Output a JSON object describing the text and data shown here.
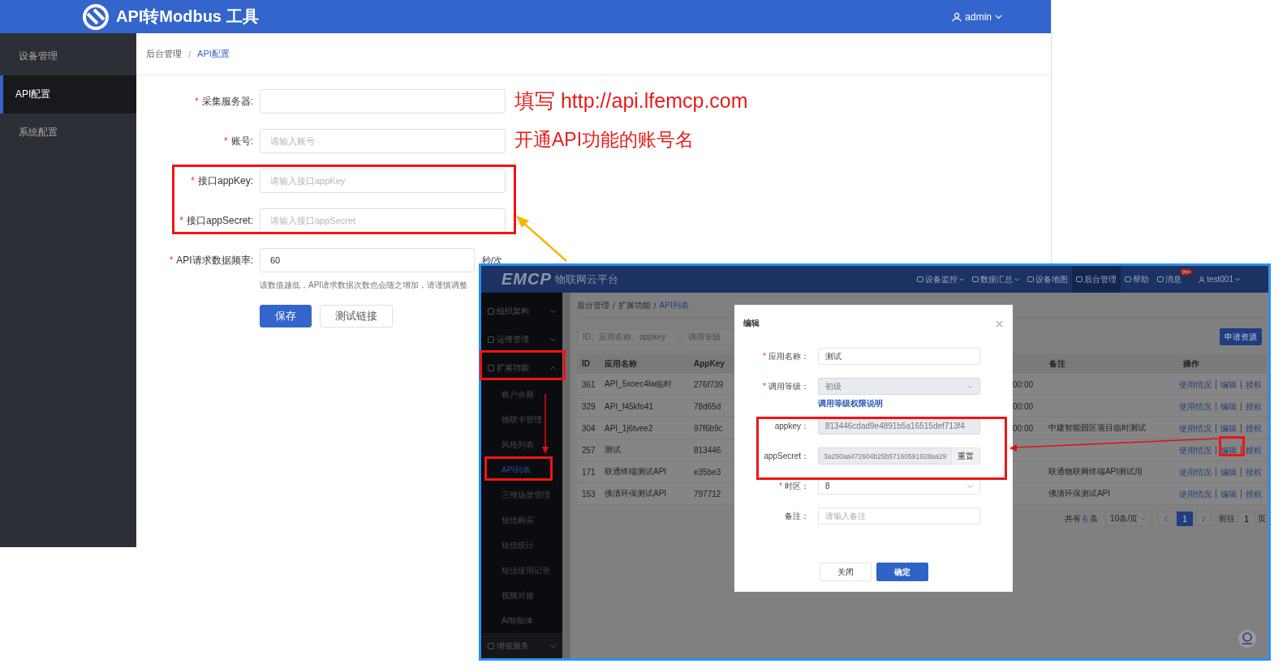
{
  "header": {
    "title": "API转Modbus 工具",
    "user": "admin"
  },
  "sidebar": {
    "items": [
      {
        "label": "设备管理",
        "selected": false
      },
      {
        "label": "API配置",
        "selected": true
      },
      {
        "label": "系统配置",
        "selected": false
      }
    ]
  },
  "breadcrumb": {
    "separator": "/",
    "items": [
      {
        "label": "后台管理",
        "current": false
      },
      {
        "label": "API配置",
        "current": true
      }
    ]
  },
  "form": {
    "fields": [
      {
        "required_mark": "*",
        "label": "采集服务器:"
      },
      {
        "required_mark": "*",
        "label": "账号:",
        "placeholder": "请输入账号"
      },
      {
        "required_mark": "*",
        "label": "接口appKey:",
        "placeholder": "请输入接口appKey"
      },
      {
        "required_mark": "*",
        "label": "接口appSecret:",
        "placeholder": "请输入接口appSecret"
      },
      {
        "required_mark": "*",
        "label": "API请求数据频率:",
        "value": "60",
        "suffix": "秒/次",
        "hint": "该数值越低，API请求数据次数也会随之增加，请谨慎调整"
      }
    ],
    "buttons": [
      {
        "label": "保存",
        "kind": "primary"
      },
      {
        "label": "测试链接",
        "kind": "default"
      }
    ]
  },
  "annotations": {
    "notes": [
      "填写 http://api.lfemcp.com",
      "开通API功能的账号名"
    ]
  },
  "embedded_screenshot": {
    "brand": "EMCP",
    "brand_subtitle": "物联网云平台",
    "nav": [
      {
        "label": "设备监控",
        "caret": true,
        "selected": false
      },
      {
        "label": "数据汇总",
        "caret": true,
        "selected": false
      },
      {
        "label": "设备地图",
        "caret": false,
        "selected": false
      },
      {
        "label": "后台管理",
        "caret": false,
        "selected": true
      },
      {
        "label": "帮助",
        "caret": false,
        "selected": false
      },
      {
        "label": "消息",
        "caret": false,
        "selected": false,
        "badge": "99+"
      }
    ],
    "user": "test001",
    "sidebar": [
      {
        "label": "组织架构",
        "expanded": false
      },
      {
        "label": "运维管理",
        "expanded": false
      },
      {
        "label": "扩展功能",
        "expanded": true,
        "children": [
          {
            "label": "账户余额",
            "selected": false
          },
          {
            "label": "物联卡管理",
            "selected": false
          },
          {
            "label": "风格列表",
            "selected": false
          },
          {
            "label": "API列表",
            "selected": true
          },
          {
            "label": "三维场景管理",
            "selected": false
          },
          {
            "label": "短信购买",
            "selected": false
          },
          {
            "label": "短信统计",
            "selected": false
          },
          {
            "label": "短信使用记录",
            "selected": false
          },
          {
            "label": "视频对接",
            "selected": false
          },
          {
            "label": "AI智能体",
            "selected": false
          }
        ]
      },
      {
        "label": "增值服务",
        "expanded": false
      }
    ],
    "breadcrumb": {
      "separator": "/",
      "items": [
        {
          "label": "后台管理",
          "current": false
        },
        {
          "label": "扩展功能",
          "current": false
        },
        {
          "label": "API列表",
          "current": true
        }
      ]
    },
    "search": {
      "placeholder": "ID、应用名称、appkey"
    },
    "level_filter": {
      "placeholder": "调用等级"
    },
    "apply_button": "申请资源",
    "table": {
      "columns_left": [
        "ID",
        "应用名称",
        "AppKey"
      ],
      "columns_right": [
        "备注",
        "操作"
      ],
      "rows": [
        {
          "id": "361",
          "name": "API_5xoec4lw临时",
          "appkey": "276f739",
          "time": "00:00",
          "actions": [
            "使用情况",
            "编辑",
            "授权"
          ]
        },
        {
          "id": "329",
          "name": "API_f45kfo41",
          "appkey": "78d65d",
          "time": "00:00",
          "actions": [
            "使用情况",
            "编辑",
            "授权"
          ]
        },
        {
          "id": "304",
          "name": "API_1j6tvee2",
          "appkey": "97f6b9c",
          "time": "00:00",
          "note": "中建智能园区项目临时测试",
          "actions": [
            "使用情况",
            "编辑",
            "授权"
          ]
        },
        {
          "id": "257",
          "name": "测试",
          "appkey": "813446",
          "actions": [
            "使用情况",
            "编辑",
            "授权"
          ]
        },
        {
          "id": "171",
          "name": "联通终端测试API",
          "appkey": "e35be3",
          "note": "联通物联网终端API测试用",
          "actions": [
            "使用情况",
            "编辑",
            "授权"
          ]
        },
        {
          "id": "153",
          "name": "佛清环保测试API",
          "appkey": "797712",
          "note": "佛清环保测试API",
          "actions": [
            "使用情况",
            "编辑",
            "授权"
          ]
        }
      ]
    },
    "pagination": {
      "total_label": "共有",
      "total": "6",
      "total_unit": "条",
      "page_size": "10条/页",
      "pages": [
        {
          "label": "1",
          "selected": true
        }
      ],
      "goto_label": "前往",
      "goto_value": "1",
      "goto_unit": "页"
    },
    "modal": {
      "title": "编辑",
      "fields": [
        {
          "kind": "input",
          "required_mark": "*",
          "label": "应用名称：",
          "value": "测试",
          "disabled": false
        },
        {
          "kind": "select",
          "required_mark": "*",
          "label": "调用等级：",
          "value": "初级",
          "disabled": true
        },
        {
          "kind": "link",
          "label": "调用等级权限说明"
        },
        {
          "kind": "input",
          "label": "appkey：",
          "value": "813446cdad9e4891b5a16515def713f4",
          "disabled": true
        },
        {
          "kind": "input",
          "label": "appSecret：",
          "value": "3a250aa472604b25b57160591928aa29",
          "disabled": true,
          "action": "重置"
        },
        {
          "kind": "select",
          "required_mark": "*",
          "label": "时区：",
          "value": "8",
          "disabled": false
        },
        {
          "kind": "input",
          "label": "备注：",
          "placeholder": "请输入备注",
          "disabled": false
        }
      ],
      "buttons": [
        {
          "label": "关闭",
          "kind": "default"
        },
        {
          "label": "确定",
          "kind": "primary"
        }
      ]
    }
  }
}
